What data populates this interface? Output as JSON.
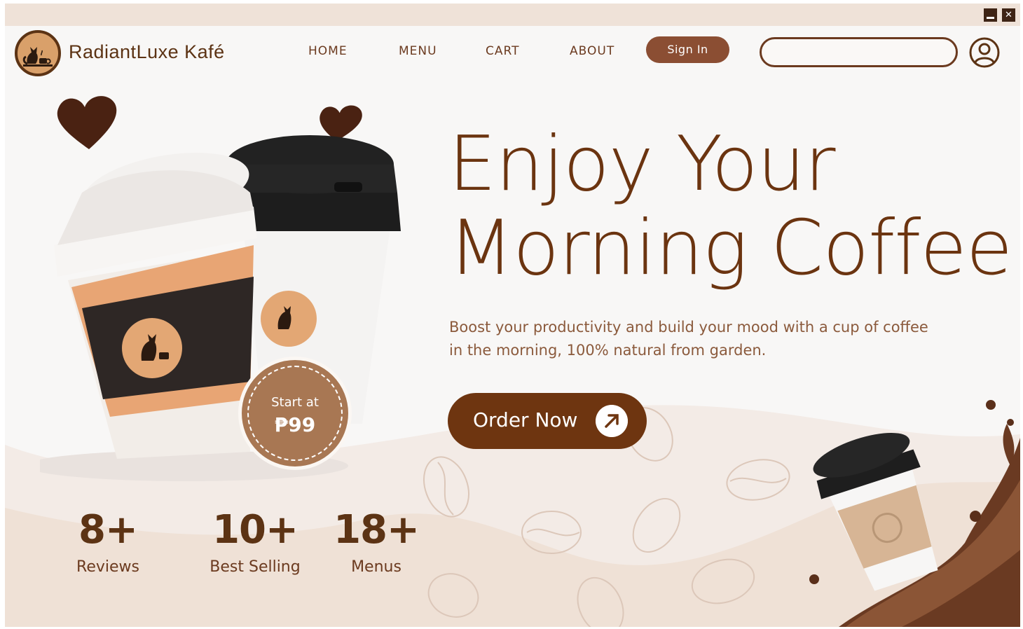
{
  "window": {
    "minimize_icon": "minimize-icon",
    "close_icon": "close-icon",
    "close_glyph": "✕"
  },
  "header": {
    "brand": "RadiantLuxe Kafé",
    "logo_icon": "cat-coffee-logo",
    "nav": {
      "home": "HOME",
      "menu": "MENU",
      "cart": "CART",
      "about": "ABOUT"
    },
    "sign_in": "Sign In",
    "search_placeholder": "",
    "user_icon": "user-icon"
  },
  "hero": {
    "headline_line1": "Enjoy Your",
    "headline_line2": "Morning Coffee",
    "tagline": "Boost your productivity and build your mood with a cup of coffee in the morning, 100% natural from garden.",
    "order_button": "Order Now",
    "order_icon": "arrow-up-right-icon"
  },
  "price_badge": {
    "label": "Start at",
    "value": "₱99"
  },
  "stats": [
    {
      "value": "8+",
      "label": "Reviews"
    },
    {
      "value": "10+",
      "label": "Best Selling"
    },
    {
      "value": "18+",
      "label": "Menus"
    }
  ],
  "colors": {
    "brand_brown": "#6e3510",
    "accent_tan": "#d9a06a",
    "sign_in_bg": "#8b4e33",
    "badge_bg": "#a87753",
    "title_bar": "#efe2d8",
    "wave_light": "#f0e3da"
  }
}
